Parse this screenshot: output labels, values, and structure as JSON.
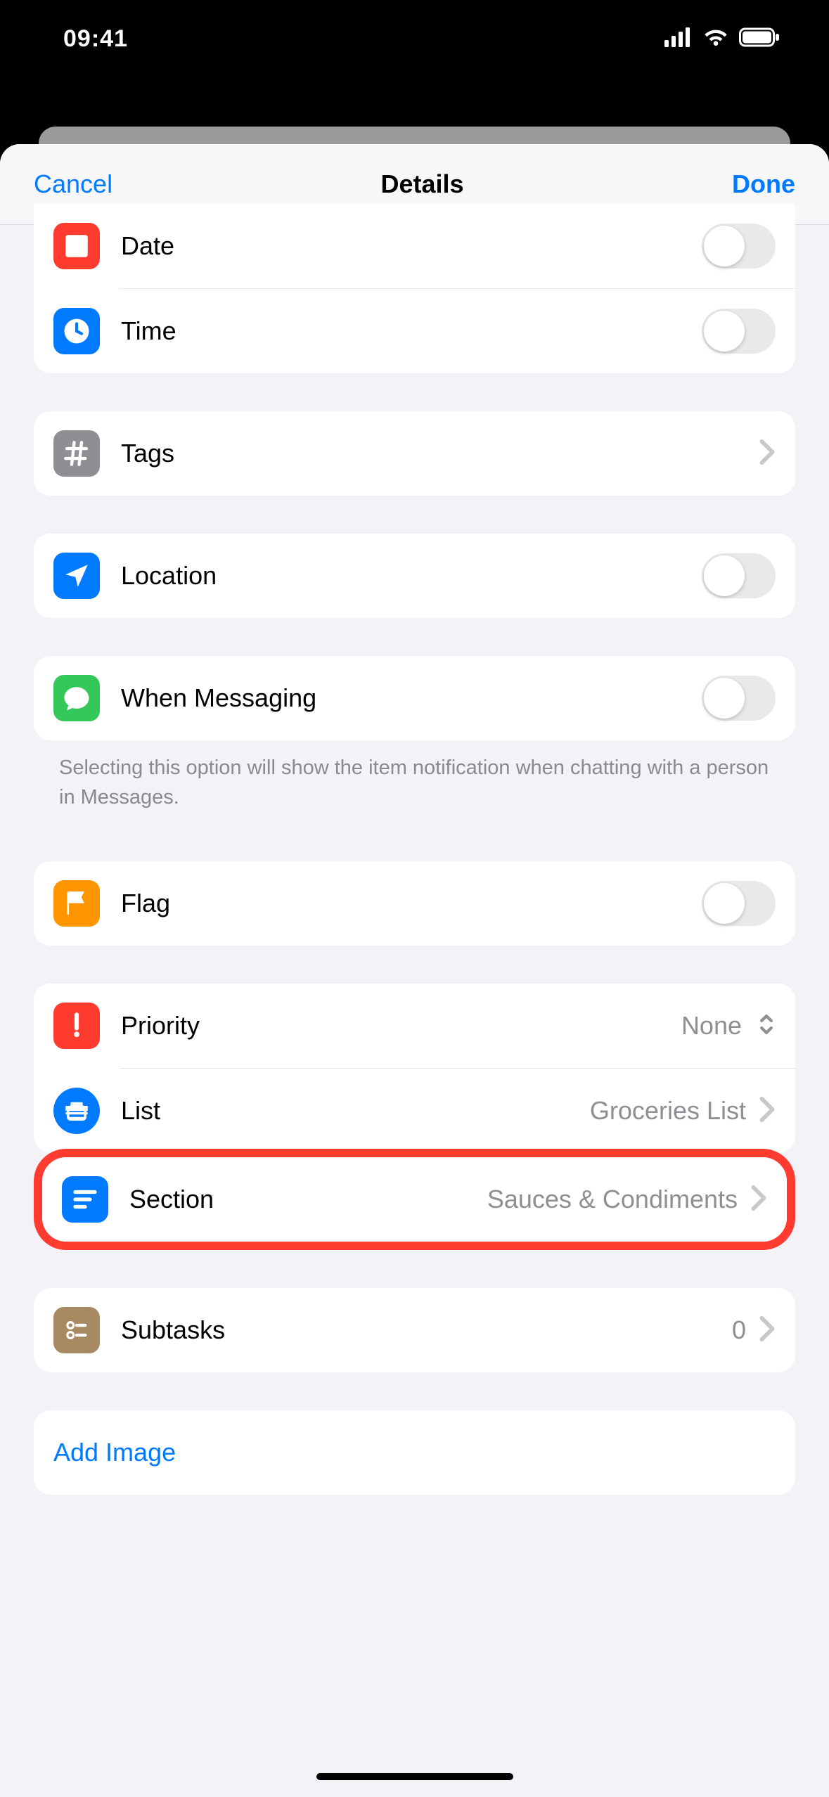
{
  "statusbar": {
    "time": "09:41"
  },
  "nav": {
    "cancel": "Cancel",
    "title": "Details",
    "done": "Done"
  },
  "rows": {
    "date": "Date",
    "time": "Time",
    "tags": "Tags",
    "location": "Location",
    "messaging": "When Messaging",
    "flag": "Flag",
    "priority": "Priority",
    "priority_value": "None",
    "list": "List",
    "list_value": "Groceries List",
    "section": "Section",
    "section_value": "Sauces & Condiments",
    "subtasks": "Subtasks",
    "subtasks_value": "0",
    "add_image": "Add Image"
  },
  "footer": {
    "messaging": "Selecting this option will show the item notification when chatting with a person in Messages."
  }
}
